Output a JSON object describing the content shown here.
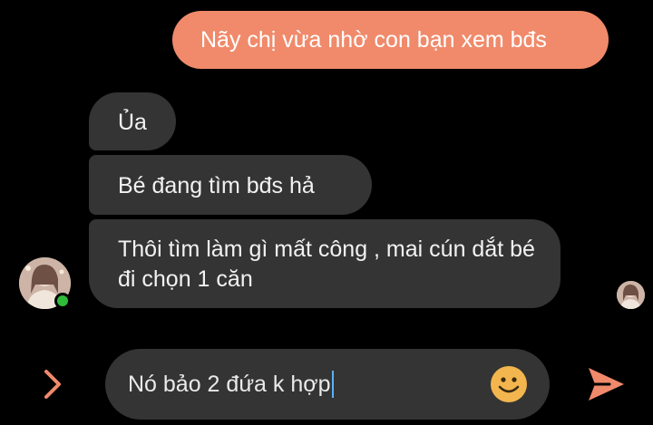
{
  "messages": {
    "sent": [
      {
        "text": "Nãy chị vừa nhờ con bạn xem bđs"
      }
    ],
    "received": [
      {
        "text": "Ủa"
      },
      {
        "text": "Bé đang tìm bđs hả"
      },
      {
        "text": "Thôi tìm làm gì mất công , mai cún dắt bé đi chọn 1 căn"
      }
    ]
  },
  "composer": {
    "draft_text": "Nó bảo 2 đứa k hợp"
  },
  "icons": {
    "expand": "chevron-right-icon",
    "emoji": "smiley-icon",
    "send": "send-icon"
  },
  "colors": {
    "background": "#000000",
    "sent_bubble": "#f08a6b",
    "received_bubble": "#343434",
    "accent": "#f08a6b",
    "online": "#2ebd3b",
    "emoji": "#f3b64e"
  }
}
